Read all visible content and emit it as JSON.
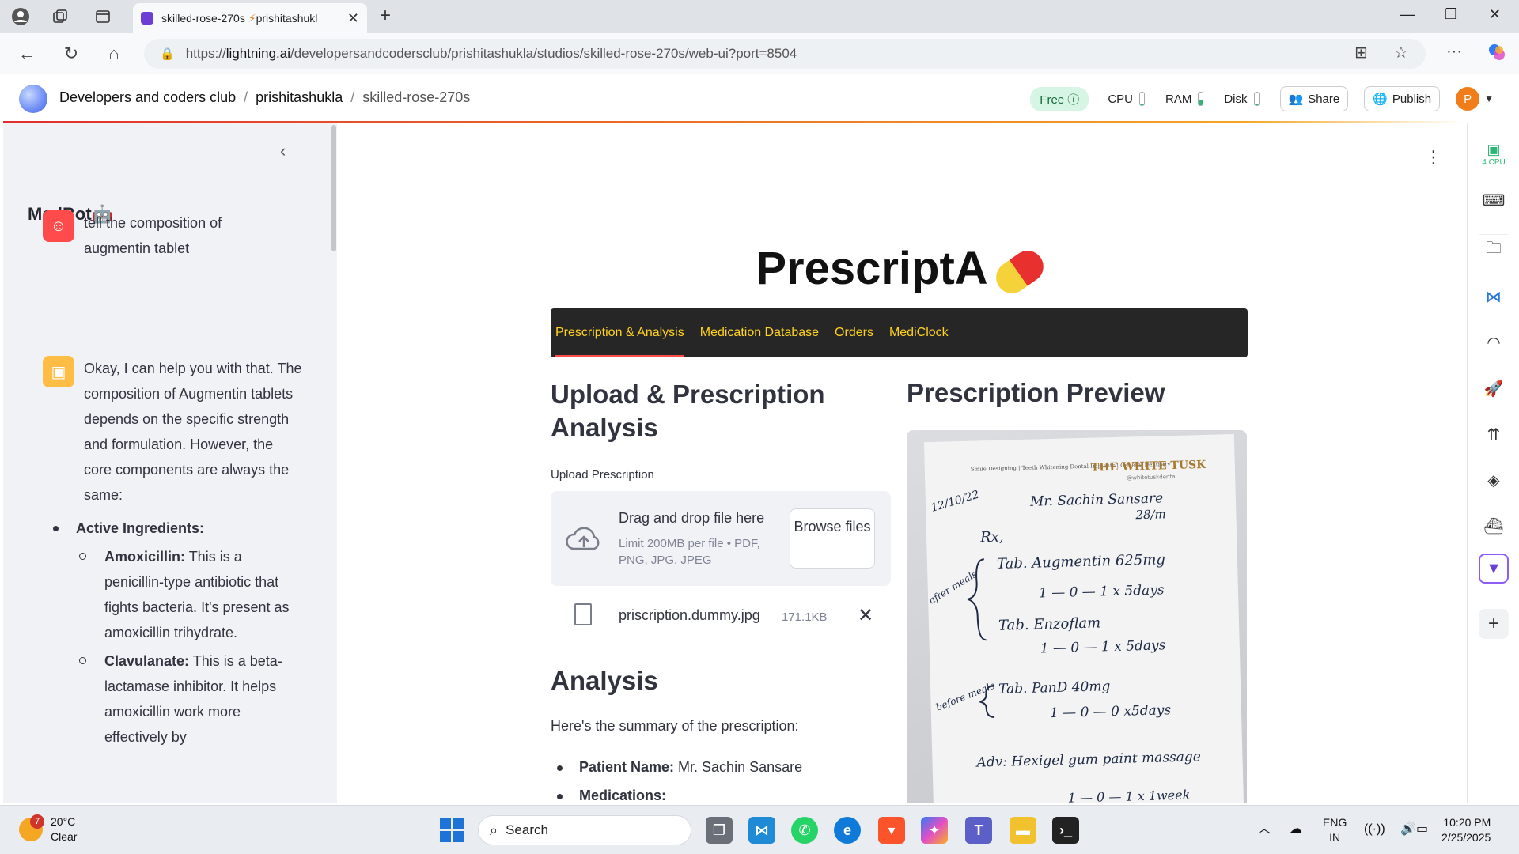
{
  "browser": {
    "tab_title": "skilled-rose-270s",
    "tab_title_suffix": "prishitashukl",
    "url_prefix": "https://",
    "url_domain": "lightning.ai",
    "url_path": "/developersandcodersclub/prishitashukla/studios/skilled-rose-270s/web-ui?port=8504"
  },
  "lightning": {
    "breadcrumb": [
      "Developers and coders club",
      "prishitashukla",
      "skilled-rose-270s"
    ],
    "plan_badge": "Free",
    "resources": [
      {
        "label": "CPU",
        "level": 0.05
      },
      {
        "label": "RAM",
        "level": 0.45
      },
      {
        "label": "Disk",
        "level": 0.05
      }
    ],
    "share_label": "Share",
    "publish_label": "Publish",
    "avatar_initial": "P",
    "rail_cpu_label": "4 CPU"
  },
  "sidebar": {
    "title": "MedBot",
    "user_message": "tell the composition of augmentin tablet",
    "bot_intro": "Okay, I can help you with that. The composition of Augmentin tablets depends on the specific strength and formulation. However, the core components are always the same:",
    "bot_list_heading": "Active Ingredients:",
    "bot_items": [
      {
        "term": "Amoxicillin:",
        "text": " This is a penicillin-type antibiotic that fights bacteria. It's present as amoxicillin trihydrate."
      },
      {
        "term": "Clavulanate:",
        "text": " This is a beta-lactamase inhibitor. It helps amoxicillin work more effectively by"
      }
    ]
  },
  "main": {
    "app_title": "PrescriptA",
    "tabs": [
      "Prescription & Analysis",
      "Medication Database",
      "Orders",
      "MediClock"
    ],
    "active_tab": 0,
    "upload_heading": "Upload & Prescription Analysis",
    "preview_heading": "Prescription Preview",
    "upload_label": "Upload Prescription",
    "dropzone_main": "Drag and drop file here",
    "dropzone_sub": "Limit 200MB per file • PDF, PNG, JPG, JPEG",
    "browse_label": "Browse files",
    "file_name": "priscription.dummy.jpg",
    "file_size": "171.1KB",
    "analysis_heading": "Analysis",
    "analysis_summary": "Here's the summary of the prescription:",
    "analysis_items": [
      {
        "term": "Patient Name:",
        "text": " Mr. Sachin Sansare"
      },
      {
        "term": "Medications:",
        "text": ""
      }
    ]
  },
  "prescription_image": {
    "clinic_tagline": "Smile Designing | Teeth Whitening Dental Implants | General Dentistry",
    "clinic_name": "THE WHITE TUSK",
    "clinic_handle": "@whitetuskdental",
    "date": "12/10/22",
    "patient": "Mr. Sachin Sansare",
    "patient_age": "28/m",
    "rx": "Rx,",
    "group1_label": "after meals",
    "line1": "Tab. Augmentin 625mg",
    "line1_dose": "1 — 0 — 1   x 5days",
    "line2": "Tab. Enzoflam",
    "line2_dose": "1 — 0 — 1   x 5days",
    "group2_label": "before meals",
    "line3": "Tab. PanD 40mg",
    "line3_dose": "1 — 0 — 0   x5days",
    "advice": "Adv: Hexigel gum paint massage",
    "advice_dose": "1 — 0 — 1   x 1week"
  },
  "taskbar": {
    "weather_temp": "20°C",
    "weather_desc": "Clear",
    "weather_badge": "7",
    "search_label": "Search",
    "lang_top": "ENG",
    "lang_bottom": "IN",
    "time": "10:20 PM",
    "date": "2/25/2025"
  },
  "colors": {
    "tab_text": "#ffd21f",
    "tab_bar": "#262626",
    "active_underline": "#ff4b4b",
    "sidebar_bg": "#f0f2f6",
    "user_avatar": "#ff4b4b",
    "bot_avatar": "#ffbd45"
  }
}
